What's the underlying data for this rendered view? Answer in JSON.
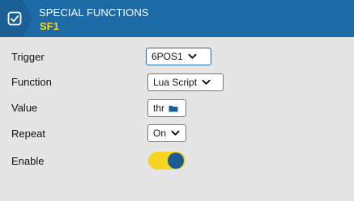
{
  "header": {
    "title": "SPECIAL FUNCTIONS",
    "subtitle": "SF1",
    "icon": "checkbox-icon"
  },
  "form": {
    "trigger": {
      "label": "Trigger",
      "value": "6POS1",
      "icon": "chevron-down-icon"
    },
    "function": {
      "label": "Function",
      "value": "Lua Script",
      "icon": "chevron-down-icon"
    },
    "value": {
      "label": "Value",
      "value": "thr",
      "icon": "folder-icon"
    },
    "repeat": {
      "label": "Repeat",
      "value": "On",
      "icon": "chevron-down-icon"
    },
    "enable": {
      "label": "Enable",
      "state": "on"
    }
  },
  "colors": {
    "header_bg": "#1c6aa6",
    "accent_yellow": "#ffd21f",
    "toggle_track": "#f5d521",
    "toggle_knob": "#1c5c94",
    "page_bg": "#e5e5e5"
  }
}
